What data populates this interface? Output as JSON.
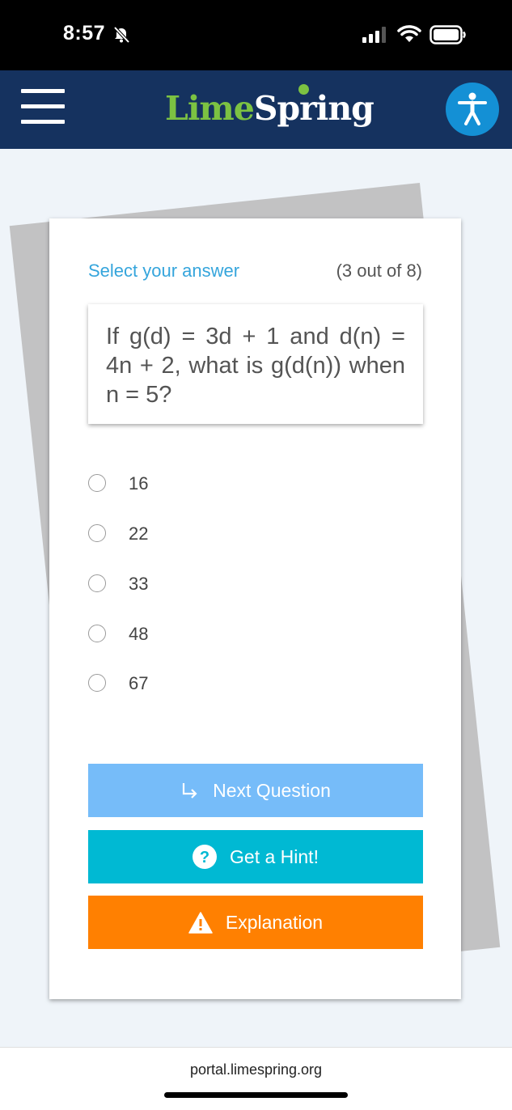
{
  "status_bar": {
    "time": "8:57",
    "icons": [
      "bell-slash-icon",
      "cellular-signal-icon",
      "wifi-icon",
      "battery-icon"
    ]
  },
  "header": {
    "logo_part1": "Lime",
    "logo_part2": "Spring",
    "menu_icon": "hamburger-icon",
    "accessibility_icon": "accessibility-person-icon"
  },
  "quiz": {
    "instruction": "Select your answer",
    "progress": "(3 out of 8)",
    "question": "If g(d) = 3d + 1 and d(n) = 4n + 2, what is g(d(n)) when n = 5?",
    "answers": [
      "16",
      "22",
      "33",
      "48",
      "67"
    ],
    "buttons": {
      "next": "Next Question",
      "hint": "Get a Hint!",
      "explanation": "Explanation"
    }
  },
  "browser": {
    "url": "portal.limespring.org"
  },
  "colors": {
    "header_bg": "#15325f",
    "brand_green": "#7cc242",
    "accent_blue": "#35a5dc",
    "next_button": "#76bcf9",
    "hint_button": "#00b9d3",
    "explanation_button": "#ff8001"
  }
}
